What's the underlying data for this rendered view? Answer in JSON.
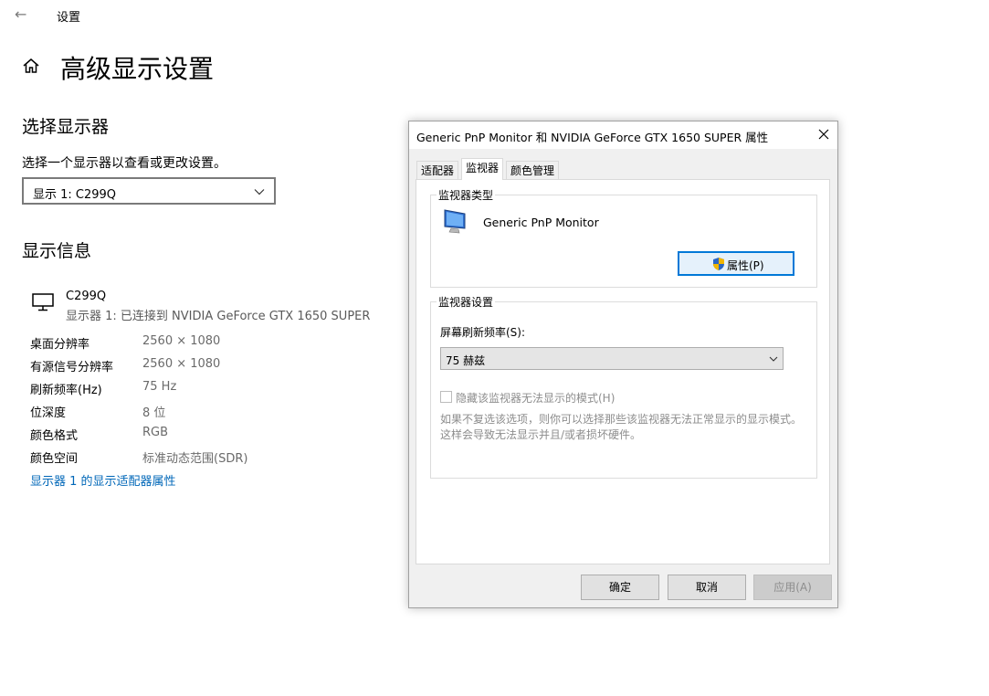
{
  "window": {
    "title": "设置",
    "back_icon": "back-arrow-icon"
  },
  "header": {
    "title": "高级显示设置",
    "home_icon": "home-icon"
  },
  "select_display": {
    "heading": "选择显示器",
    "description": "选择一个显示器以查看或更改设置。",
    "selected": "显示 1: C299Q"
  },
  "display_info": {
    "heading": "显示信息",
    "monitor_name": "C299Q",
    "monitor_desc": "显示器 1: 已连接到 NVIDIA GeForce GTX 1650 SUPER",
    "rows": [
      {
        "label": "桌面分辨率",
        "value": "2560 × 1080"
      },
      {
        "label": "有源信号分辨率",
        "value": "2560 × 1080"
      },
      {
        "label": "刷新频率(Hz)",
        "value": "75 Hz"
      },
      {
        "label": "位深度",
        "value": "8 位"
      },
      {
        "label": "颜色格式",
        "value": "RGB"
      },
      {
        "label": "颜色空间",
        "value": "标准动态范围(SDR)"
      }
    ],
    "adapter_link": "显示器 1 的显示适配器属性"
  },
  "dialog": {
    "title": "Generic PnP Monitor 和 NVIDIA GeForce GTX 1650 SUPER 属性",
    "tabs": [
      {
        "label": "适配器",
        "active": false
      },
      {
        "label": "监视器",
        "active": true
      },
      {
        "label": "颜色管理",
        "active": false
      }
    ],
    "monitor_type": {
      "legend": "监视器类型",
      "name": "Generic PnP Monitor",
      "properties_button": "属性(P)"
    },
    "monitor_settings": {
      "legend": "监视器设置",
      "refresh_label": "屏幕刷新频率(S):",
      "refresh_value": "75 赫兹",
      "hide_modes_label": "隐藏该监视器无法显示的模式(H)",
      "hide_modes_checked": false,
      "hint_line1": "如果不复选该选项，则你可以选择那些该监视器无法正常显示的显示模式。",
      "hint_line2": "这样会导致无法显示并且/或者损坏硬件。"
    },
    "buttons": {
      "ok": "确定",
      "cancel": "取消",
      "apply": "应用(A)"
    }
  },
  "colors": {
    "link": "#0067b8",
    "focus_border": "#0078d7",
    "dialog_bg": "#f0f0f0"
  }
}
